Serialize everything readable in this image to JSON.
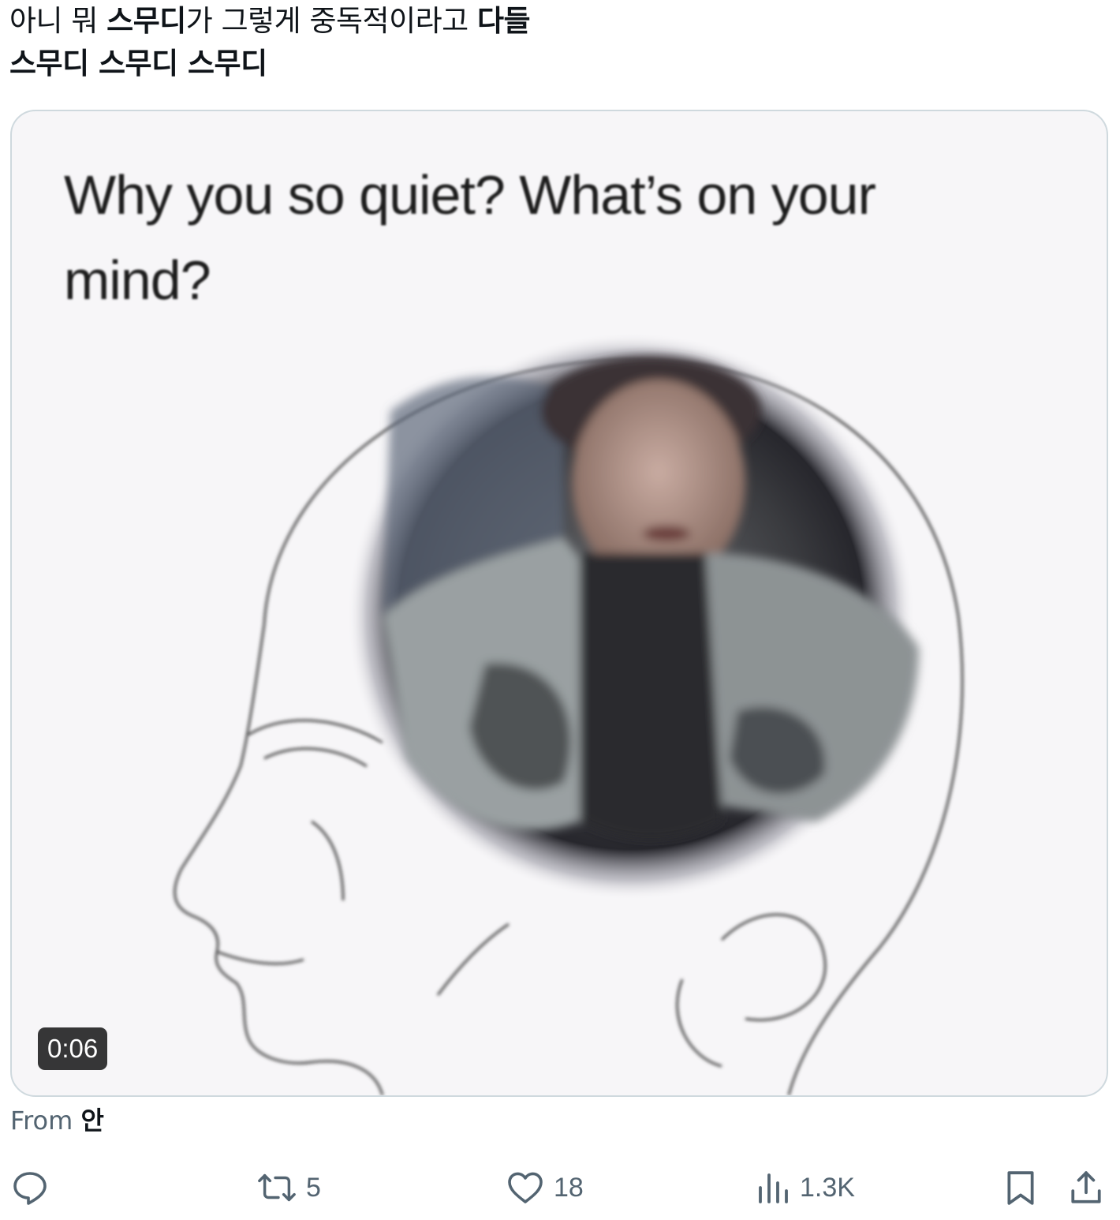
{
  "tweet": {
    "line1_a": "아니 뭐 ",
    "line1_b": "스무디",
    "line1_c": "가 그렇게 중독적이라고 ",
    "line1_d": "다들",
    "line2": "스무디 스무디 스무디"
  },
  "media": {
    "caption_line1": "Why you so quiet? What’s on your",
    "caption_line2": "mind?",
    "duration": "0:06"
  },
  "source": {
    "prefix": "From ",
    "name": "안"
  },
  "actions": {
    "reply_count": "",
    "retweet_count": "5",
    "like_count": "18",
    "views_count": "1.3K"
  },
  "icons": [
    "reply-icon",
    "retweet-icon",
    "like-icon",
    "views-icon",
    "bookmark-icon",
    "share-icon"
  ],
  "colors": {
    "text": "#0f1419",
    "secondary": "#536471",
    "border": "#cfd9de"
  }
}
